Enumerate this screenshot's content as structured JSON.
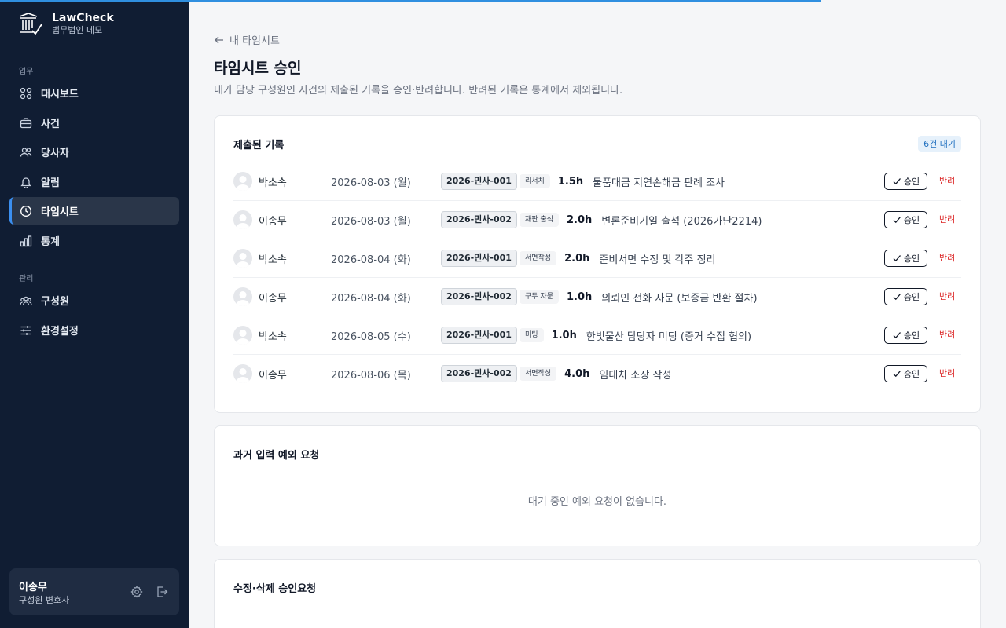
{
  "app": {
    "name": "LawCheck",
    "subtitle": "법무법인 데모"
  },
  "sidebar": {
    "sections": {
      "work": "업무",
      "admin": "관리"
    },
    "items": [
      {
        "label": "대시보드",
        "icon": "grid-icon"
      },
      {
        "label": "사건",
        "icon": "briefcase-icon"
      },
      {
        "label": "당사자",
        "icon": "users-icon"
      },
      {
        "label": "알림",
        "icon": "bell-icon"
      },
      {
        "label": "타임시트",
        "icon": "clock-icon",
        "active": true
      },
      {
        "label": "통계",
        "icon": "bar-chart-icon"
      },
      {
        "label": "구성원",
        "icon": "team-icon"
      },
      {
        "label": "환경설정",
        "icon": "sliders-icon"
      }
    ],
    "user": {
      "name": "이송무",
      "role": "구성원 변호사"
    }
  },
  "page": {
    "back_label": "내 타임시트",
    "title": "타임시트 승인",
    "description": "내가 담당 구성원인 사건의 제출된 기록을 승인·반려합니다. 반려된 기록은 통계에서 제외됩니다."
  },
  "submitted": {
    "title": "제출된 기록",
    "badge": "6건 대기",
    "approve_label": "승인",
    "reject_label": "반려",
    "rows": [
      {
        "name": "박소속",
        "date": "2026-08-03 (월)",
        "case": "2026-민사-001",
        "type": "리서치",
        "hours": "1.5h",
        "desc": "물품대금 지연손해금 판례 조사"
      },
      {
        "name": "이송무",
        "date": "2026-08-03 (월)",
        "case": "2026-민사-002",
        "type": "재판 출석",
        "hours": "2.0h",
        "desc": "변론준비기일 출석 (2026가단2214)"
      },
      {
        "name": "박소속",
        "date": "2026-08-04 (화)",
        "case": "2026-민사-001",
        "type": "서면작성",
        "hours": "2.0h",
        "desc": "준비서면 수정 및 각주 정리"
      },
      {
        "name": "이송무",
        "date": "2026-08-04 (화)",
        "case": "2026-민사-002",
        "type": "구두 자문",
        "hours": "1.0h",
        "desc": "의뢰인 전화 자문 (보증금 반환 절차)"
      },
      {
        "name": "박소속",
        "date": "2026-08-05 (수)",
        "case": "2026-민사-001",
        "type": "미팅",
        "hours": "1.0h",
        "desc": "한빛물산 담당자 미팅 (증거 수집 협의)"
      },
      {
        "name": "이송무",
        "date": "2026-08-06 (목)",
        "case": "2026-민사-002",
        "type": "서면작성",
        "hours": "4.0h",
        "desc": "임대차 소장 작성"
      }
    ]
  },
  "exceptions": {
    "title": "과거 입력 예외 요청",
    "empty": "대기 중인 예외 요청이 없습니다."
  },
  "edit_requests": {
    "title": "수정·삭제 승인요청"
  }
}
